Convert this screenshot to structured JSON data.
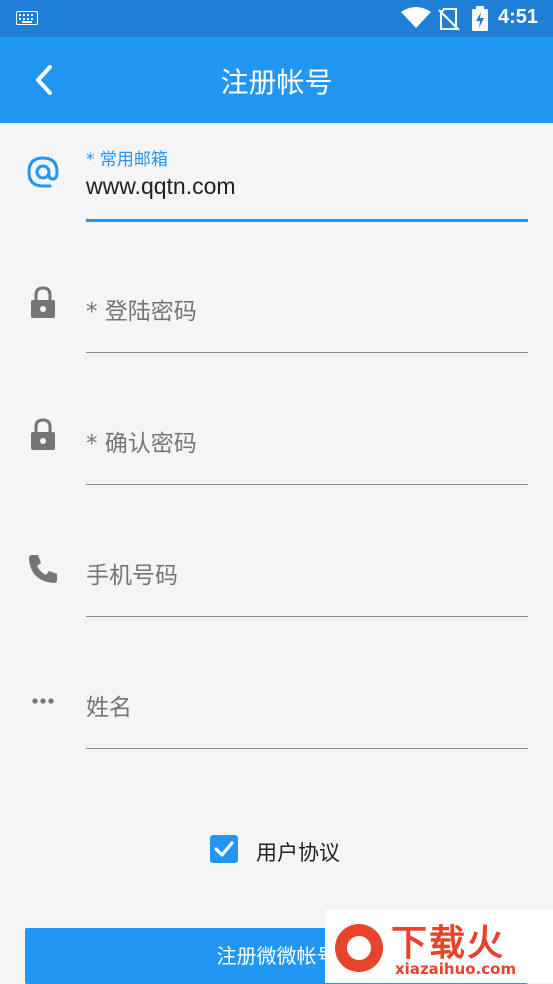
{
  "status": {
    "time": "4:51"
  },
  "header": {
    "title": "注册帐号",
    "back_icon": "chevron-left-icon"
  },
  "form": {
    "email": {
      "label": "* 常用邮箱",
      "value": "www.qqtn.com",
      "icon": "at-icon"
    },
    "password": {
      "placeholder": "* 登陆密码",
      "icon": "lock-icon"
    },
    "confirm": {
      "placeholder": "* 确认密码",
      "icon": "lock-icon"
    },
    "phone": {
      "placeholder": "手机号码",
      "icon": "phone-icon"
    },
    "name": {
      "placeholder": "姓名",
      "icon": "more-horizontal-icon"
    }
  },
  "agreement": {
    "label": "用户协议",
    "checked": true
  },
  "submit": {
    "label": "注册微微帐号"
  },
  "watermark": {
    "brand": "下载火",
    "domain": "xiazaihuo.com"
  },
  "colors": {
    "primary": "#2196f3",
    "statusbar": "#1f7fd6",
    "background": "#f5f5f5"
  }
}
